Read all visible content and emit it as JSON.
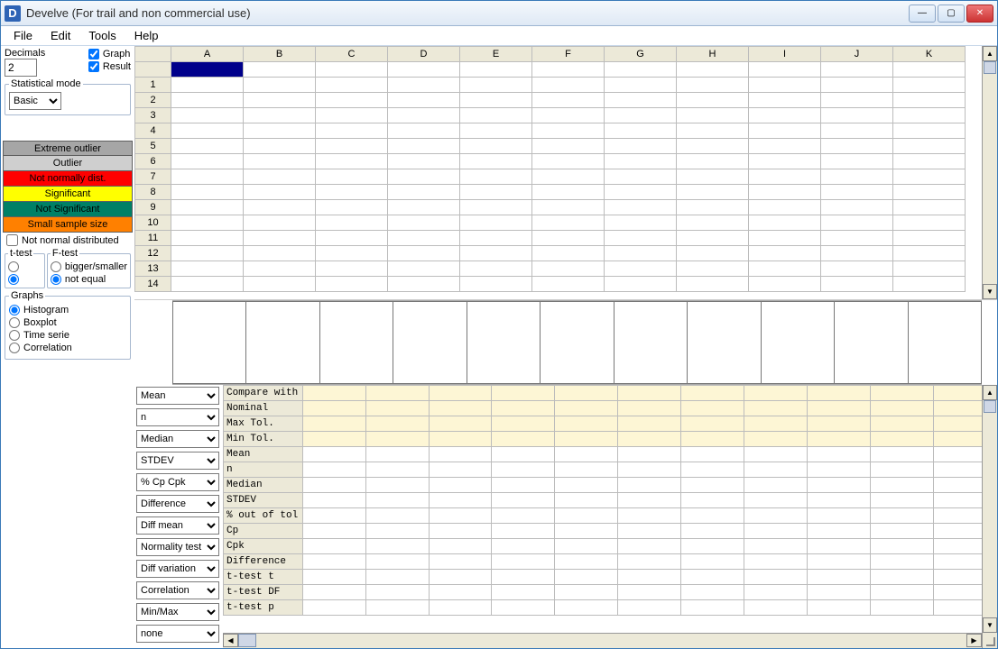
{
  "title": "Develve (For trail and non commercial use)",
  "menu": [
    "File",
    "Edit",
    "Tools",
    "Help"
  ],
  "left": {
    "decimals_label": "Decimals",
    "decimals_value": "2",
    "graph_chk": "Graph",
    "result_chk": "Result",
    "stat_mode_label": "Statistical mode",
    "stat_mode_value": "Basic",
    "legend": {
      "extreme": "Extreme outlier",
      "outlier": "Outlier",
      "notnorm": "Not normally dist.",
      "sig": "Significant",
      "notsig": "Not Significant",
      "small": "Small sample size"
    },
    "not_normal_distributed": "Not normal distributed",
    "ttest_label": "t-test",
    "ftest_label": "F-test",
    "ftest_opt1": "bigger/smaller",
    "ftest_opt2": "not equal",
    "graphs_label": "Graphs",
    "graphs_opts": [
      "Histogram",
      "Boxplot",
      "Time serie",
      "Correlation"
    ]
  },
  "sheet": {
    "col_headers": [
      "A",
      "B",
      "C",
      "D",
      "E",
      "F",
      "G",
      "H",
      "I",
      "J",
      "K"
    ],
    "row_headers": [
      "1",
      "2",
      "3",
      "4",
      "5",
      "6",
      "7",
      "8",
      "9",
      "10",
      "11",
      "12",
      "13",
      "14"
    ]
  },
  "stat_select_values": [
    "Mean",
    "n",
    "Median",
    "STDEV",
    "% Cp Cpk",
    "Difference",
    "Diff mean",
    "Normality test",
    "Diff variation",
    "Correlation",
    "Min/Max",
    "none"
  ],
  "results": {
    "rows": [
      "Compare with",
      "Nominal",
      "Max Tol.",
      "Min Tol.",
      "Mean",
      "n",
      "Median",
      "STDEV",
      "% out of tol",
      "Cp",
      "Cpk",
      "Difference",
      "t-test t",
      "t-test DF",
      "t-test p"
    ],
    "yellow_rows": [
      0,
      1,
      2,
      3
    ]
  }
}
